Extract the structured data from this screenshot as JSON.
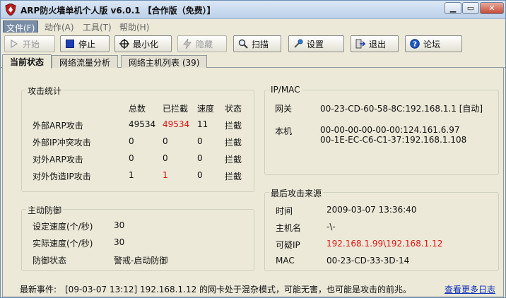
{
  "window": {
    "title": "ARP防火墙单机个人版 v6.0.1 【合作版（免费）】"
  },
  "menu": [
    {
      "label": "文件(F)",
      "active": true
    },
    {
      "label": "动作(A)",
      "active": false
    },
    {
      "label": "工具(T)",
      "active": false
    },
    {
      "label": "帮助(H)",
      "active": false
    }
  ],
  "toolbar": {
    "start": "开始",
    "stop": "停止",
    "minimize": "最小化",
    "hide": "隐藏",
    "scan": "扫描",
    "settings": "设置",
    "exit": "退出",
    "forum": "论坛"
  },
  "tabs": [
    {
      "label": "当前状态",
      "active": true
    },
    {
      "label": "网络流量分析",
      "active": false
    },
    {
      "label": "网络主机列表 (39)",
      "active": false
    }
  ],
  "attack_stats": {
    "title": "攻击统计",
    "headers": [
      "总数",
      "已拦截",
      "速度",
      "状态"
    ],
    "rows": [
      {
        "label": "外部ARP攻击",
        "total": "49534",
        "blocked": "49534",
        "speed": "11",
        "status": "拦截"
      },
      {
        "label": "外部IP冲突攻击",
        "total": "0",
        "blocked": "0",
        "speed": "0",
        "status": "拦截"
      },
      {
        "label": "对外ARP攻击",
        "total": "0",
        "blocked": "0",
        "speed": "0",
        "status": "拦截"
      },
      {
        "label": "对外伪造IP攻击",
        "total": "1",
        "blocked": "1",
        "speed": "0",
        "status": "拦截"
      }
    ]
  },
  "active_defense": {
    "title": "主动防御",
    "set_speed_label": "设定速度(个/秒)",
    "set_speed_value": "30",
    "actual_speed_label": "实际速度(个/秒)",
    "actual_speed_value": "30",
    "status_label": "防御状态",
    "status_value": "警戒-启动防御"
  },
  "ip_mac": {
    "title": "IP/MAC",
    "gateway_label": "网关",
    "gateway_value": "00-23-CD-60-58-8C:192.168.1.1 [自动]",
    "local_label": "本机",
    "local_value_1": "00-00-00-00-00-00:124.161.6.97",
    "local_value_2": "00-1E-EC-C6-C1-37:192.168.1.108"
  },
  "last_attack": {
    "title": "最后攻击来源",
    "time_label": "时间",
    "time_value": "2009-03-07 13:36:40",
    "host_label": "主机名",
    "host_value": "-\\-",
    "ip_label": "可疑IP",
    "ip_value": "192.168.1.99\\192.168.1.12",
    "mac_label": "MAC",
    "mac_value": "00-23-CD-33-3D-14"
  },
  "footer": {
    "event_label": "最新事件:",
    "event_text": "[09-03-07 13:12] 192.168.1.12 的网卡处于混杂模式，可能无害，也可能是攻击的前兆。",
    "more_log_link": "查看更多日志"
  },
  "colors": {
    "alert_red": "#e01010",
    "link_blue": "#0a2db8"
  }
}
